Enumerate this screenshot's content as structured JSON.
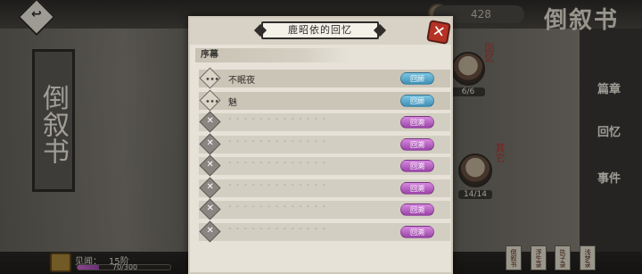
{
  "background": {
    "vertical_title": "倒叙书",
    "logo": "倒叙书",
    "currency_value": "428",
    "side_tabs": [
      "篇章",
      "回忆",
      "事件"
    ],
    "characters": [
      {
        "count": "6/6",
        "red_label": "回忆"
      },
      {
        "count": "14/14",
        "red_label": "其它"
      }
    ],
    "exp_label": "见闻：",
    "exp_rank": "15阶",
    "exp_progress": "70/300",
    "exp_fraction": 0.233,
    "cards": [
      "倒叙书",
      "浮生录",
      "执子录",
      "浅梦录"
    ]
  },
  "panel": {
    "title": "鹿昭依的回忆",
    "close_label": "✕",
    "section": "序幕",
    "rows": [
      {
        "title": "不眠夜",
        "button": "回顾",
        "unlocked": true
      },
      {
        "title": "魅",
        "button": "回顾",
        "unlocked": true
      },
      {
        "title": "- - - - - - - - - - - - -",
        "button": "回溯",
        "unlocked": false
      },
      {
        "title": "- - - - - - - - - - - - -",
        "button": "回溯",
        "unlocked": false
      },
      {
        "title": "- - - - - - - - - - - - -",
        "button": "回溯",
        "unlocked": false
      },
      {
        "title": "- - - - - - - - - - - - -",
        "button": "回溯",
        "unlocked": false
      },
      {
        "title": "- - - - - - - - - - - - -",
        "button": "回溯",
        "unlocked": false
      },
      {
        "title": "- - - - - - - - - - - - -",
        "button": "回溯",
        "unlocked": false
      }
    ]
  },
  "colors": {
    "accent_blue": "#3f8fb5",
    "accent_purple": "#9a44a7",
    "close_red": "#b53224"
  }
}
